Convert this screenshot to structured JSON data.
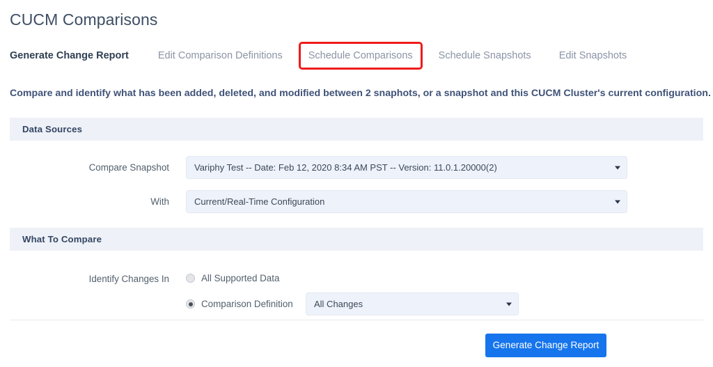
{
  "page": {
    "title": "CUCM Comparisons",
    "intro": "Compare and identify what has been added, deleted, and modified between 2 snaphots, or a snapshot and this CUCM Cluster's current configuration."
  },
  "tabs": [
    {
      "label": "Generate Change Report",
      "active": true,
      "highlighted": false
    },
    {
      "label": "Edit Comparison Definitions",
      "active": false,
      "highlighted": false
    },
    {
      "label": "Schedule Comparisons",
      "active": false,
      "highlighted": true
    },
    {
      "label": "Schedule Snapshots",
      "active": false,
      "highlighted": false
    },
    {
      "label": "Edit Snapshots",
      "active": false,
      "highlighted": false
    }
  ],
  "sections": {
    "data_sources": {
      "header": "Data Sources",
      "compare_snapshot": {
        "label": "Compare Snapshot",
        "value": "Variphy Test -- Date: Feb 12, 2020 8:34 AM PST -- Version: 11.0.1.20000(2)"
      },
      "with": {
        "label": "With",
        "value": "Current/Real-Time Configuration"
      }
    },
    "what_to_compare": {
      "header": "What To Compare",
      "identify_changes_in": {
        "label": "Identify Changes In",
        "option_all_supported_data": "All Supported Data",
        "option_comparison_definition": "Comparison Definition",
        "selected": "comparison_definition",
        "definition_value": "All Changes"
      }
    }
  },
  "footer": {
    "generate_button": "Generate Change Report"
  },
  "colors": {
    "accent_blue": "#1675ec",
    "highlight_red": "#f01b1b",
    "title_slate": "#3d4d63",
    "section_header_bg": "#eef1f7",
    "field_bg": "#eef2fa"
  },
  "icons": {
    "caret": "chevron-down-icon"
  }
}
